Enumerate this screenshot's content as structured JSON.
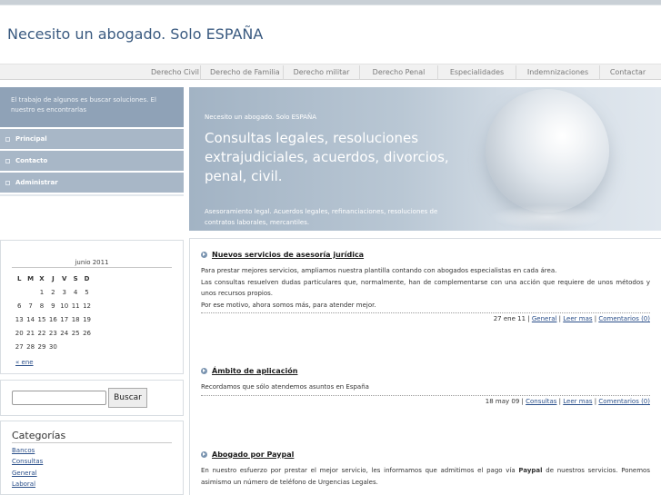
{
  "site": {
    "title": "Necesito un abogado. Solo ESPAÑA"
  },
  "nav": {
    "items": [
      "Derecho Civil",
      "Derecho de Familia",
      "Derecho militar",
      "Derecho Penal",
      "Especialidades",
      "Indemnizaciones",
      "Contactar"
    ]
  },
  "sidebar": {
    "tagline": "El trabajo de algunos es buscar soluciones. El nuestro es encontrarlas",
    "menu": [
      "Principal",
      "Contacto",
      "Administrar"
    ]
  },
  "hero": {
    "small": "Necesito un abogado. Solo ESPAÑA",
    "headline": "Consultas legales, resoluciones extrajudiciales, acuerdos, divorcios, penal, civil.",
    "description": "Asesoramiento legal. Acuerdos legales, refinanciaciones, resoluciones de contratos laborales, mercantiles."
  },
  "calendar": {
    "month": "junio 2011",
    "weekdays": [
      "L",
      "M",
      "X",
      "J",
      "V",
      "S",
      "D"
    ],
    "weeks": [
      [
        "",
        "",
        "1",
        "2",
        "3",
        "4",
        "5"
      ],
      [
        "6",
        "7",
        "8",
        "9",
        "10",
        "11",
        "12"
      ],
      [
        "13",
        "14",
        "15",
        "16",
        "17",
        "18",
        "19"
      ],
      [
        "20",
        "21",
        "22",
        "23",
        "24",
        "25",
        "26"
      ],
      [
        "27",
        "28",
        "29",
        "30",
        "",
        "",
        ""
      ]
    ],
    "prev_link": "« ene"
  },
  "search": {
    "button_label": "Buscar",
    "value": ""
  },
  "categories": {
    "title": "Categorías",
    "items": [
      "Bancos",
      "Consultas",
      "General",
      "Laboral"
    ]
  },
  "posts": [
    {
      "title": "Nuevos servicios de asesoría jurídica",
      "body": [
        "Para prestar mejores servicios, ampliamos nuestra plantilla contando con abogados especialistas en cada área.",
        "Las consultas resuelven dudas particulares que, normalmente, han de complementarse con una acción que requiere de unos métodos y unos recursos propios.",
        "Por ese motivo, ahora somos más, para atender mejor."
      ],
      "date": "27 ene 11",
      "category": "General",
      "read_more": "Leer mas",
      "comments": "Comentarios (0)"
    },
    {
      "title": "Ámbito de aplicación",
      "body": [
        "Recordamos que sólo atendemos asuntos en España"
      ],
      "date": "18 may 09",
      "category": "Consultas",
      "read_more": "Leer mas",
      "comments": "Comentarios (0)"
    },
    {
      "title": "Abogado por Paypal",
      "body_pre": "En nuestro esfuerzo por prestar el mejor servicio, les informamos que admitimos el pago vía ",
      "body_bold": "Paypal",
      "body_post": " de nuestros servicios. Ponemos asimismo un número de teléfono de Urgencias Legales."
    }
  ],
  "colors": {
    "accent_blue": "#3a5a80",
    "menu_bg": "#a8b7c7",
    "tagline_bg": "#8fa2b7",
    "link": "#2a4f8a"
  }
}
